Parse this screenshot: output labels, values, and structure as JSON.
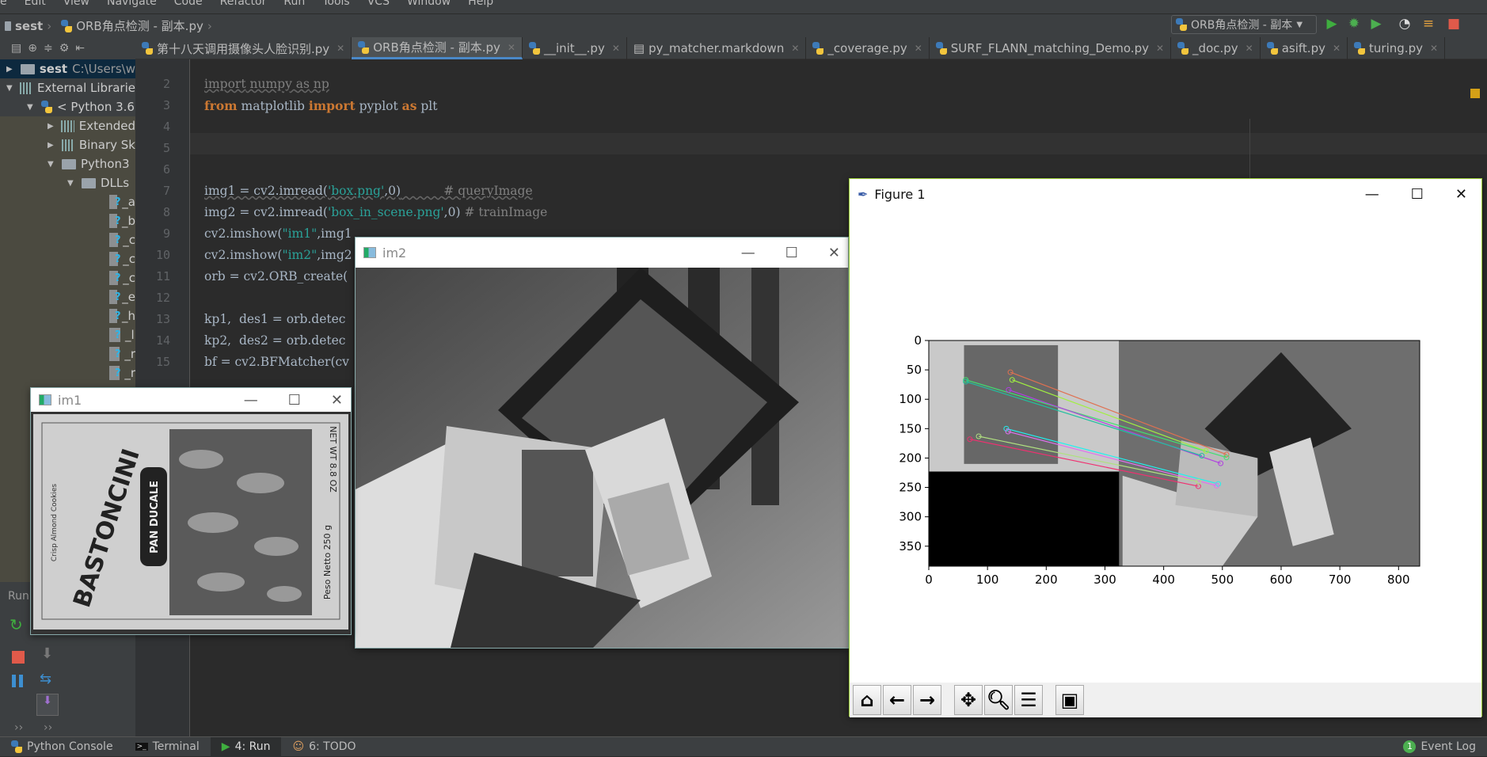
{
  "menu": [
    "e",
    "Edit",
    "View",
    "Navigate",
    "Code",
    "Refactor",
    "Run",
    "Tools",
    "VCS",
    "Window",
    "Help"
  ],
  "breadcrumb": {
    "project": "sest",
    "file": "ORB角点检测 - 副本.py"
  },
  "run_config": "ORB角点检测 - 副本",
  "tabs": [
    {
      "label": "第十八天调用摄像头人脸识别.py",
      "active": false
    },
    {
      "label": "ORB角点检测 - 副本.py",
      "active": true
    },
    {
      "label": "__init__.py",
      "active": false
    },
    {
      "label": "py_matcher.markdown",
      "active": false
    },
    {
      "label": "_coverage.py",
      "active": false
    },
    {
      "label": "SURF_FLANN_matching_Demo.py",
      "active": false
    },
    {
      "label": "_doc.py",
      "active": false
    },
    {
      "label": "asift.py",
      "active": false
    },
    {
      "label": "turing.py",
      "active": false
    }
  ],
  "project_tree": {
    "root": {
      "name": "sest",
      "path": "C:\\Users\\w"
    },
    "items": [
      "External Librarie",
      "< Python 3.6",
      "Extended",
      "Binary Sk",
      "Python3",
      "DLLs"
    ],
    "files": [
      "_a",
      "_b",
      "_c",
      "_c",
      "_c",
      "_e",
      "_h",
      "_l",
      "_r",
      "_r"
    ]
  },
  "code": {
    "line_numbers": [
      "2",
      "3",
      "4",
      "5",
      "6",
      "7",
      "8",
      "9",
      "10",
      "11",
      "12",
      "13",
      "14",
      "15"
    ],
    "l2": {
      "kw1": "import",
      "a": " numpy ",
      "kw2": "as",
      "b": " np"
    },
    "l3": {
      "kw1": "from",
      "a": " matplotlib ",
      "kw2": "import",
      "b": " pyplot ",
      "kw3": "as",
      "c": " plt"
    },
    "l7": {
      "a": "img1 = cv2.imread(",
      "s": "'box.png'",
      "b": ",0)",
      "c": "# queryImage"
    },
    "l8": {
      "a": "img2 = cv2.imread(",
      "s": "'box_in_scene.png'",
      "b": ",0)",
      "c": "# trainImage"
    },
    "l9": {
      "a": "cv2.imshow(",
      "s": "\"im1\"",
      "b": ",img1"
    },
    "l10": {
      "a": "cv2.imshow(",
      "s": "\"im2\"",
      "b": ",img2"
    },
    "l11": "orb = cv2.ORB_create(",
    "l13": "kp1,  des1 = orb.detec",
    "l14": "kp2,  des2 = orb.detec",
    "l15": "bf = cv2.BFMatcher(cv"
  },
  "run_panel": {
    "label": "Run:"
  },
  "windows": {
    "im1": {
      "title": "im1",
      "box_text": [
        "BASTONCINI",
        "PAN DUCALE",
        "Crisp Almond Cookies",
        "Peso Netto 250 g",
        "NET WT 8.8 OZ"
      ]
    },
    "im2": {
      "title": "im2"
    },
    "figure": {
      "title": "Figure 1"
    }
  },
  "chart_data": {
    "type": "image",
    "xlim": [
      0,
      836
    ],
    "ylim": [
      384,
      0
    ],
    "xticks": [
      "0",
      "100",
      "200",
      "300",
      "400",
      "500",
      "600",
      "700",
      "800"
    ],
    "yticks": [
      "0",
      "50",
      "100",
      "150",
      "200",
      "250",
      "300",
      "350"
    ],
    "matches": [
      {
        "color": "#e07050",
        "from": [
          139,
          54
        ],
        "to": [
          507,
          194
        ]
      },
      {
        "color": "#40e070",
        "from": [
          63,
          67
        ],
        "to": [
          507,
          199
        ]
      },
      {
        "color": "#a0f040",
        "from": [
          142,
          67
        ],
        "to": [
          472,
          188
        ]
      },
      {
        "color": "#b040e0",
        "from": [
          136,
          84
        ],
        "to": [
          497,
          209
        ]
      },
      {
        "color": "#20c0a0",
        "from": [
          63,
          70
        ],
        "to": [
          465,
          196
        ]
      },
      {
        "color": "#20f0f0",
        "from": [
          132,
          150
        ],
        "to": [
          493,
          244
        ]
      },
      {
        "color": "#e070f0",
        "from": [
          135,
          155
        ],
        "to": [
          490,
          247
        ]
      },
      {
        "color": "#f03070",
        "from": [
          70,
          168
        ],
        "to": [
          459,
          248
        ]
      },
      {
        "color": "#b0e080",
        "from": [
          85,
          163
        ],
        "to": [
          459,
          240
        ]
      }
    ]
  },
  "mpl_toolbar": [
    "home",
    "back",
    "forward",
    "pan",
    "zoom",
    "configure",
    "save"
  ],
  "statusbar": {
    "python_console": "Python Console",
    "terminal": "Terminal",
    "run": "4: Run",
    "todo": "6: TODO",
    "event_log": "Event Log",
    "event_count": "1"
  }
}
